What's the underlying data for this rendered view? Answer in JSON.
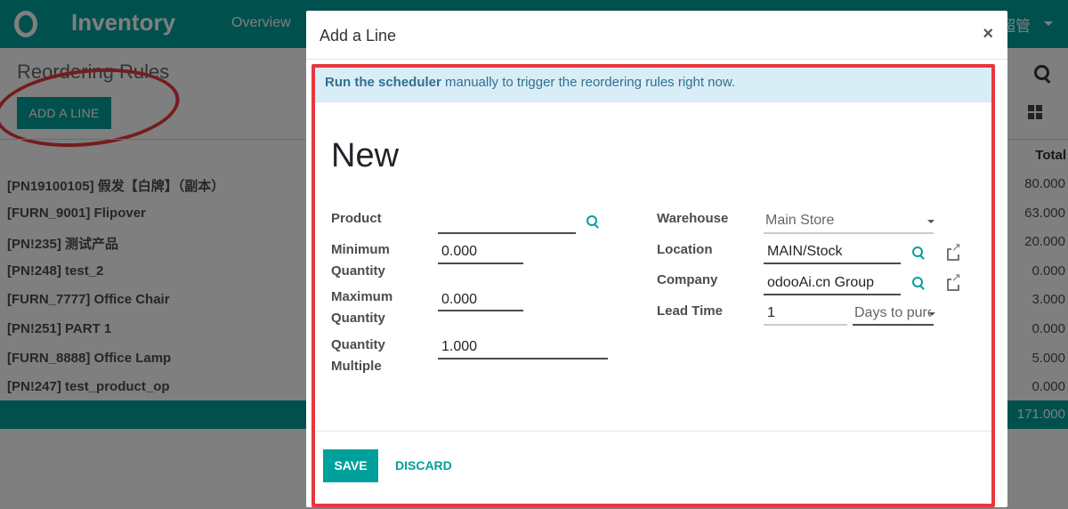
{
  "app": {
    "title": "Inventory",
    "nav_overview": "Overview",
    "user_name": "超管",
    "user_icon": "caret-down-icon"
  },
  "control_panel": {
    "title": "Reordering Rules",
    "add_line_label": "ADD A LINE",
    "search_icon": "search-icon",
    "view_icon": "kanban-icon"
  },
  "list": {
    "total_header": "Total",
    "rows": [
      {
        "name": "[PN19100105] 假发【白牌】（副本）",
        "total": "80.000"
      },
      {
        "name": "[FURN_9001] Flipover",
        "total": "63.000"
      },
      {
        "name": "[PN!235] 测试产品",
        "total": "20.000"
      },
      {
        "name": "[PN!248] test_2",
        "total": "0.000"
      },
      {
        "name": "[FURN_7777] Office Chair",
        "total": "3.000"
      },
      {
        "name": "[PN!251] PART 1",
        "total": "0.000"
      },
      {
        "name": "[FURN_8888] Office Lamp",
        "total": "5.000"
      },
      {
        "name": "[PN!247] test_product_op",
        "total": "0.000"
      }
    ],
    "grand_total": "171.000"
  },
  "modal": {
    "title": "Add a Line",
    "close_glyph": "×",
    "alert_bold": "Run the scheduler",
    "alert_rest": " manually to trigger the reordering rules right now.",
    "record_name": "New",
    "fields": {
      "product_label": "Product",
      "product_value": "",
      "min_qty_label_1": "Minimum",
      "min_qty_label_2": "Quantity",
      "min_qty_value": "0.000",
      "max_qty_label_1": "Maximum",
      "max_qty_label_2": "Quantity",
      "max_qty_value": "0.000",
      "qty_multiple_label_1": "Quantity",
      "qty_multiple_label_2": "Multiple",
      "qty_multiple_value": "1.000",
      "warehouse_label": "Warehouse",
      "warehouse_value": "Main Store",
      "location_label": "Location",
      "location_value": "MAIN/Stock",
      "company_label": "Company",
      "company_value": "odooAi.cn Group",
      "lead_time_label": "Lead Time",
      "lead_time_value": "1",
      "lead_type_value": "Days to purc"
    },
    "save_label": "SAVE",
    "discard_label": "DISCARD"
  },
  "annotation_color": "#e8383d",
  "brand_color": "#00a09d"
}
